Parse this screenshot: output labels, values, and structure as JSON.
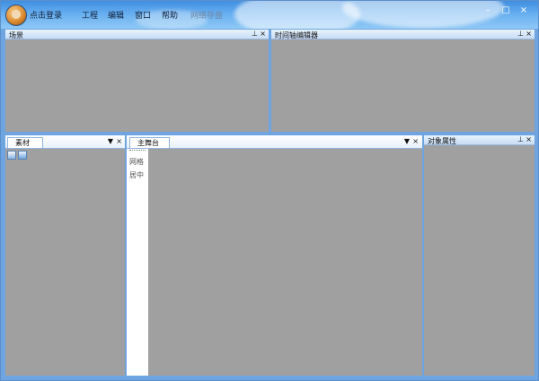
{
  "header": {
    "login": "点击登录",
    "menus": [
      "工程",
      "编辑",
      "窗口",
      "帮助",
      "网络存盘"
    ],
    "window_controls": [
      "minimize-icon",
      "maximize-icon",
      "close-icon"
    ]
  },
  "panes": {
    "scene": {
      "title": "场景"
    },
    "timeline": {
      "title": "时间轴编辑器"
    },
    "assets": {
      "tab": "素材"
    },
    "stage": {
      "tab": "主舞台",
      "labels": [
        "网格",
        "居中"
      ]
    },
    "properties": {
      "title": "对象属性"
    }
  },
  "icons": {
    "pin": "pin-icon",
    "close": "close-icon",
    "dropdown": "dropdown-icon",
    "asset_tool_1": "image-icon",
    "asset_tool_2": "folder-icon"
  },
  "colors": {
    "title_bar": "#5ea7ee",
    "panel_gray": "#a0a0a0",
    "header_blue": "#c7ddf6",
    "border_blue": "#6ea5e0"
  }
}
